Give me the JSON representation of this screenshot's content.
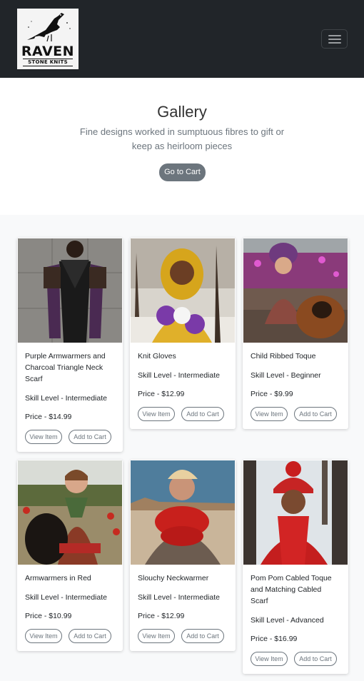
{
  "brand": {
    "name": "RAVEN",
    "tagline": "STONE KNITS"
  },
  "hero": {
    "title": "Gallery",
    "lead": "Fine designs worked in sumptuous fibres to gift or keep as heirloom pieces",
    "cart_button": "Go to Cart"
  },
  "products": [
    {
      "title": "Purple Armwarmers and Charcoal Triangle Neck Scarf",
      "skill": "Skill Level - Intermediate",
      "price": "Price - $14.99",
      "view": "View Item",
      "add": "Add to Cart"
    },
    {
      "title": "Knit Gloves",
      "skill": "Skill Level - Intermediate",
      "price": "Price - $12.99",
      "view": "View Item",
      "add": "Add to Cart"
    },
    {
      "title": "Child Ribbed Toque",
      "skill": "Skill Level - Beginner",
      "price": "Price - $9.99",
      "view": "View Item",
      "add": "Add to Cart"
    },
    {
      "title": "Armwarmers in Red",
      "skill": "Skill Level - Intermediate",
      "price": "Price - $10.99",
      "view": "View Item",
      "add": "Add to Cart"
    },
    {
      "title": "Slouchy Neckwarmer",
      "skill": "Skill Level - Intermediate",
      "price": "Price - $12.99",
      "view": "View Item",
      "add": "Add to Cart"
    },
    {
      "title": "Pom Pom Cabled Toque and Matching Cabled Scarf",
      "skill": "Skill Level - Advanced",
      "price": "Price - $16.99",
      "view": "View Item",
      "add": "Add to Cart"
    }
  ],
  "colors": {
    "navbar": "#212529",
    "button": "#6c757d",
    "page": "#f8f9fa"
  },
  "icons": {
    "menu": "hamburger-icon",
    "logo": "raven-icon"
  }
}
